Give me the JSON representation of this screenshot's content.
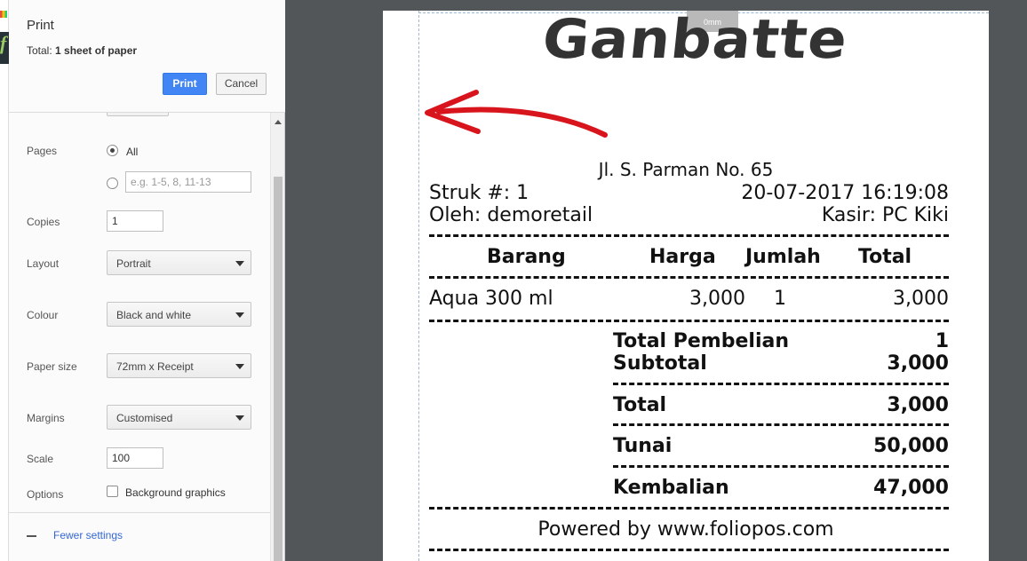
{
  "dialog": {
    "title": "Print",
    "total_label": "Total:",
    "total_value": "1 sheet of paper",
    "print_label": "Print",
    "cancel_label": "Cancel"
  },
  "settings": {
    "pages": {
      "label": "Pages",
      "all_label": "All",
      "all_selected": true,
      "range_placeholder": "e.g. 1-5, 8, 11-13"
    },
    "copies": {
      "label": "Copies",
      "value": "1"
    },
    "layout": {
      "label": "Layout",
      "value": "Portrait"
    },
    "colour": {
      "label": "Colour",
      "value": "Black and white"
    },
    "paper_size": {
      "label": "Paper size",
      "value": "72mm x Receipt"
    },
    "margins": {
      "label": "Margins",
      "value": "Customised"
    },
    "scale": {
      "label": "Scale",
      "value": "100"
    },
    "options": {
      "label": "Options",
      "background_graphics_label": "Background graphics",
      "background_graphics_checked": false
    },
    "fewer_settings_label": "Fewer settings"
  },
  "preview": {
    "margin_tag": "0mm",
    "logo_text": "Ganbatte",
    "receipt": {
      "address": "Jl. S. Parman No. 65",
      "struk": "Struk #: 1",
      "datetime": "20-07-2017 16:19:08",
      "oleh": "Oleh: demoretail",
      "kasir": "Kasir: PC Kiki",
      "headers": {
        "barang": "Barang",
        "harga": "Harga",
        "jumlah": "Jumlah",
        "total": "Total"
      },
      "items": [
        {
          "barang": "Aqua 300 ml",
          "harga": "3,000",
          "jumlah": "1",
          "total": "3,000"
        }
      ],
      "total_pembelian_label": "Total Pembelian",
      "total_pembelian_value": "1",
      "subtotal_label": "Subtotal",
      "subtotal_value": "3,000",
      "total_label": "Total",
      "total_value": "3,000",
      "tunai_label": "Tunai",
      "tunai_value": "50,000",
      "kembalian_label": "Kembalian",
      "kembalian_value": "47,000",
      "footer": "Powered by www.foliopos.com"
    }
  },
  "colors": {
    "print_button": "#4285f4",
    "link": "#3367d6",
    "arrow": "#d8141c",
    "preview_bg": "#525659"
  }
}
